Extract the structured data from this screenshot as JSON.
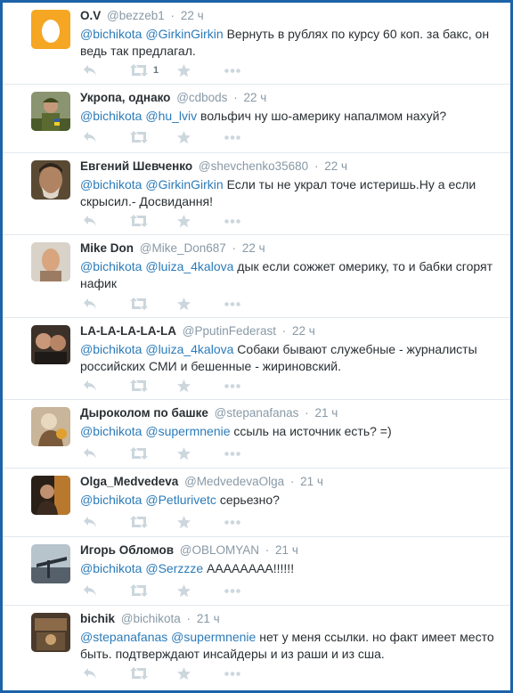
{
  "tweets": [
    {
      "name": "O.V",
      "handle": "@bezzeb1",
      "time": "22 ч",
      "mentions": [
        "@bichikota",
        "@GirkinGirkin"
      ],
      "text": "Вернуть в рублях по курсу 60 коп. за бакс, он ведь так предлагал.",
      "retweets": "1"
    },
    {
      "name": "Укропа, однако",
      "handle": "@cdbods",
      "time": "22 ч",
      "mentions": [
        "@bichikota",
        "@hu_lviv"
      ],
      "text": "вольфич ну шо-америку напалмом нахуй?",
      "retweets": ""
    },
    {
      "name": "Евгений Шевченко",
      "handle": "@shevchenko35680",
      "time": "22 ч",
      "mentions": [
        "@bichikota",
        "@GirkinGirkin"
      ],
      "text": "Если ты не украл точе истеришь.Ну а если скрысил.- Досвидання!",
      "retweets": ""
    },
    {
      "name": "Mike Don",
      "handle": "@Mike_Don687",
      "time": "22 ч",
      "mentions": [
        "@bichikota",
        "@luiza_4kalova"
      ],
      "text": "дык если сожжет омерику, то и бабки сгорят нафик",
      "retweets": ""
    },
    {
      "name": "LA-LA-LA-LA-LA",
      "handle": "@PputinFederast",
      "time": "22 ч",
      "mentions": [
        "@bichikota",
        "@luiza_4kalova"
      ],
      "text": "Собаки бывают служебные - журналисты российских СМИ и бешенные - жириновский.",
      "retweets": ""
    },
    {
      "name": "Дыроколом по башке",
      "handle": "@stepanafanas",
      "time": "21 ч",
      "mentions": [
        "@bichikota",
        "@supermnenie"
      ],
      "text": "ссыль на источник есть? =)",
      "retweets": ""
    },
    {
      "name": "Olga_Medvedeva",
      "handle": "@MedvedevaOlga",
      "time": "21 ч",
      "mentions": [
        "@bichikota",
        "@Petlurivetc"
      ],
      "text": "серьезно?",
      "retweets": ""
    },
    {
      "name": "Игорь Обломов",
      "handle": "@OBLOMYAN",
      "time": "21 ч",
      "mentions": [
        "@bichikota",
        "@Serzzze"
      ],
      "text": "АААААААА!!!!!!",
      "retweets": ""
    },
    {
      "name": "bichik",
      "handle": "@bichikota",
      "time": "21 ч",
      "mentions": [
        "@stepanafanas",
        "@supermnenie"
      ],
      "text": "нет у меня ссылки. но факт имеет место быть. подтверждают инсайдеры и из раши и из сша.",
      "retweets": ""
    }
  ],
  "colors": {
    "accent": "#2b7bb9",
    "action": "#ccd6dd",
    "border": "#e1e8ed",
    "frame": "#1d63a8"
  },
  "icons": [
    "reply-icon",
    "retweet-icon",
    "favorite-icon",
    "more-icon"
  ]
}
